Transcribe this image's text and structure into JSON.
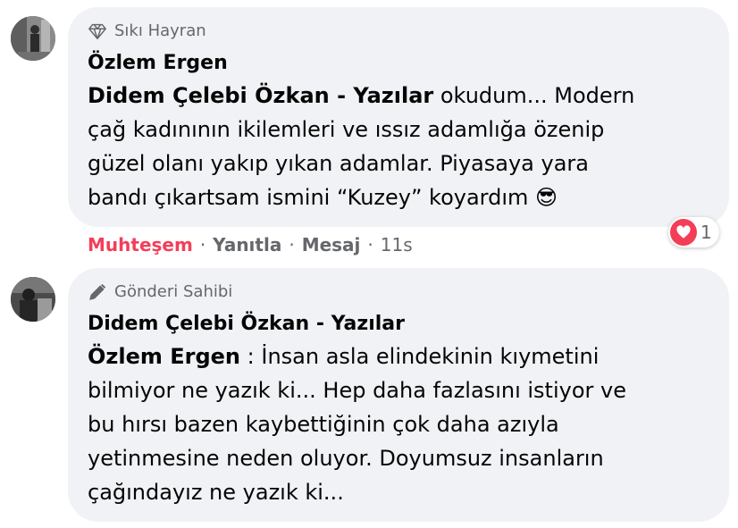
{
  "comments": [
    {
      "badge": "Sıkı Hayran",
      "badge_icon": "diamond-icon",
      "author": "Özlem Ergen",
      "mention": "Didem Çelebi Özkan - Yazılar",
      "lines": [
        " okudum... Modern",
        "çağ kadınının ikilemleri ve ıssız adamlığa özenip",
        "güzel olanı yakıp yıkan adamlar. Piyasaya yara",
        "bandı çıkartsam ismini “Kuzey” koyardım "
      ],
      "emoji": "😎",
      "actions": {
        "reaction_label": "Muhteşem",
        "reply_label": "Yanıtla",
        "message_label": "Mesaj",
        "time": "11s",
        "separator": "·"
      },
      "reaction": {
        "icon": "heart-icon",
        "count": "1",
        "color": "#f33e58"
      }
    },
    {
      "badge": "Gönderi Sahibi",
      "badge_icon": "pen-icon",
      "author": "Didem Çelebi Özkan - Yazılar",
      "mention": "Özlem Ergen",
      "lines": [
        " : İnsan asla elindekinin kıymetini",
        "bilmiyor ne yazık ki... Hep daha fazlasını istiyor ve",
        "bu hırsı bazen kaybettiğinin çok daha azıyla",
        "yetinmesine neden oluyor. Doyumsuz insanların",
        "çağındayız ne yazık ki..."
      ]
    }
  ]
}
